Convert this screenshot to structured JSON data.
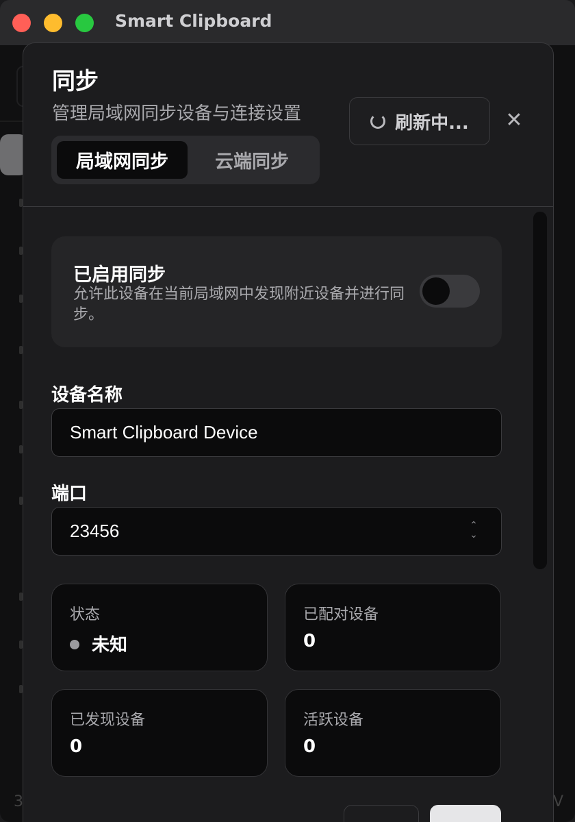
{
  "window": {
    "title": "Smart Clipboard",
    "traffic_lights": [
      "close",
      "minimize",
      "zoom"
    ]
  },
  "background_app": {
    "status_left": "3",
    "status_right": "V"
  },
  "dialog": {
    "title": "同步",
    "subtitle": "管理局域网同步设备与连接设置",
    "refresh_label": "刷新中...",
    "close_icon": "close-icon",
    "tabs": [
      {
        "label": "局域网同步",
        "active": true
      },
      {
        "label": "云端同步",
        "active": false
      }
    ],
    "sync_card": {
      "title": "已启用同步",
      "description": "允许此设备在当前局域网中发现附近设备并进行同步。",
      "enabled": false
    },
    "device_name": {
      "label": "设备名称",
      "value": "Smart Clipboard Device"
    },
    "port": {
      "label": "端口",
      "value": "23456"
    },
    "stats": {
      "status": {
        "label": "状态",
        "value": "未知"
      },
      "paired": {
        "label": "已配对设备",
        "value": "0"
      },
      "discovered": {
        "label": "已发现设备",
        "value": "0"
      },
      "active": {
        "label": "活跃设备",
        "value": "0"
      }
    }
  }
}
